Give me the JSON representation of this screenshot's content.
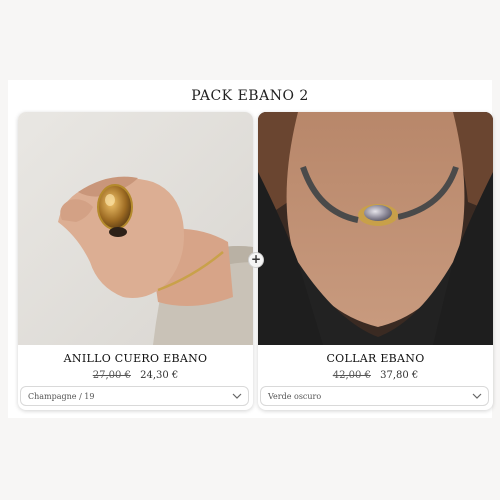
{
  "pack": {
    "title": "PACK EBANO 2"
  },
  "products": [
    {
      "name": "ANILLO CUERO EBANO",
      "old_price": "27,00 €",
      "new_price": "24,30 €",
      "variant": "Champagne / 19",
      "image": "hand-with-ring-photo"
    },
    {
      "name": "COLLAR EBANO",
      "old_price": "42,00 €",
      "new_price": "37,80 €",
      "variant": "Verde oscuro",
      "image": "neck-with-necklace-photo"
    }
  ],
  "icons": {
    "plus": "+",
    "chevron": "chevron-down-icon"
  },
  "colors": {
    "background": "#f7f6f5",
    "card": "#ffffff",
    "text": "#1f1f1f"
  }
}
